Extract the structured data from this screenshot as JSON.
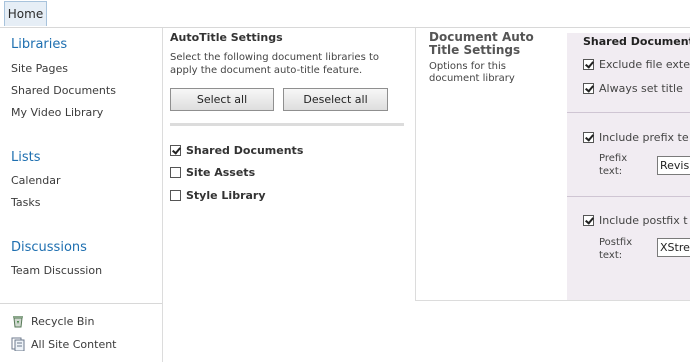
{
  "topbar": {
    "home_tab": "Home"
  },
  "leftnav": {
    "libraries_heading": "Libraries",
    "libraries": [
      "Site Pages",
      "Shared Documents",
      "My Video Library"
    ],
    "lists_heading": "Lists",
    "lists": [
      "Calendar",
      "Tasks"
    ],
    "discussions_heading": "Discussions",
    "discussions": [
      "Team Discussion"
    ],
    "recycle_bin": "Recycle Bin",
    "all_site_content": "All Site Content"
  },
  "autotitle": {
    "title": "AutoTitle Settings",
    "description": "Select the following document libraries to apply the document auto-title feature.",
    "select_all": "Select all",
    "deselect_all": "Deselect all",
    "libraries": [
      {
        "label": "Shared Documents",
        "checked": true
      },
      {
        "label": "Site Assets",
        "checked": false
      },
      {
        "label": "Style Library",
        "checked": false
      }
    ]
  },
  "doc_settings": {
    "title": "Document Auto Title Settings",
    "description": "Options for this document library"
  },
  "panel": {
    "title": "Shared Documents",
    "exclude_ext": "Exclude file exte",
    "always_set": "Always set title",
    "include_prefix": "Include prefix te",
    "prefix_label": "Prefix text:",
    "prefix_value": "Revis",
    "include_postfix": "Include postfix t",
    "postfix_label": "Postfix text:",
    "postfix_value": "XStre"
  },
  "colors": {
    "link_blue": "#1e6fb0",
    "panel_bg": "#f1ecf2"
  }
}
